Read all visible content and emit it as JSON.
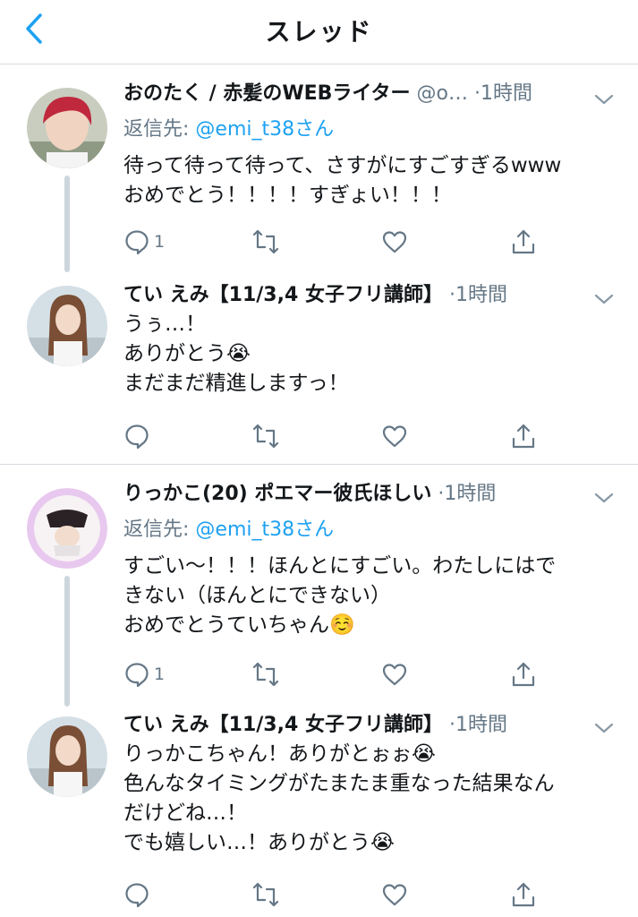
{
  "header": {
    "title": "スレッド",
    "back_icon": "chevron-left-icon"
  },
  "colors": {
    "accent": "#1da1f2",
    "secondary_text": "#657786",
    "thread_line": "#ccd6dd"
  },
  "tweets": [
    {
      "name": "おのたく / 赤髪のWEBライター",
      "handle": "@o…",
      "time": "1時間",
      "reply_prefix": "返信先: ",
      "reply_mention": "@emi_t38さん",
      "body": "待って待って待って、さすがにすごすぎるwww\nおめでとう！！！！すぎょい！！！",
      "reply_count": "1"
    },
    {
      "name": "てい えみ【11/3,4 女子フリ講師】",
      "time": "1時間",
      "body": "うぅ…！\nありがとう😭\nまだまだ精進しますっ！"
    },
    {
      "name": "りっかこ(20)  ポエマー彼氏ほしい",
      "time": "1時間",
      "reply_prefix": "返信先: ",
      "reply_mention": "@emi_t38さん",
      "body": "すごい〜！！！ほんとにすごい。わたしにはで\nきない（ほんとにできない）\nおめでとうていちゃん☺️",
      "reply_count": "1"
    },
    {
      "name": "てい えみ【11/3,4 女子フリ講師】",
      "time": "1時間",
      "body": "りっかこちゃん！ありがとぉぉ😭\n色んなタイミングがたまたま重なった結果なん\nだけどね…！\nでも嬉しい…！ありがとう😭"
    }
  ],
  "dot": "·"
}
